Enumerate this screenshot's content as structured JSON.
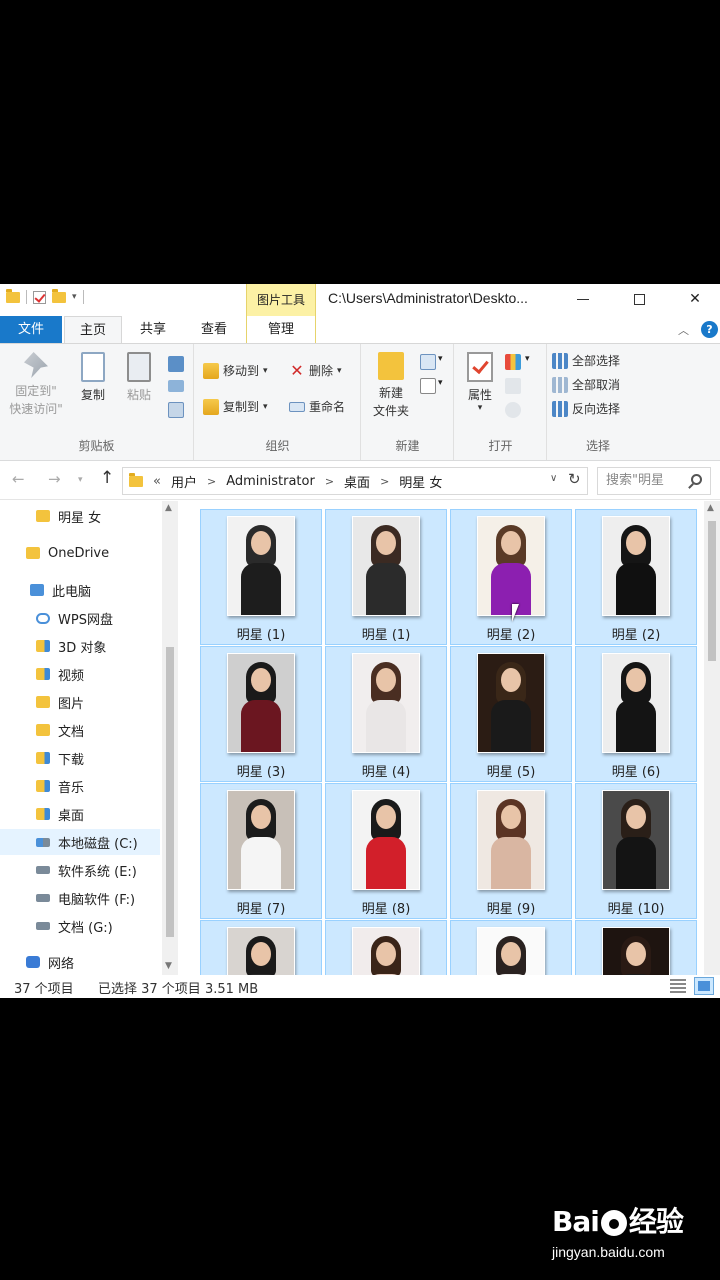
{
  "titlebar": {
    "context_tab_group": "图片工具",
    "path": "C:\\Users\\Administrator\\Deskto...",
    "minimize": "—",
    "maximize": "□",
    "close": "✕"
  },
  "tabs": {
    "file": "文件",
    "home": "主页",
    "share": "共享",
    "view": "查看",
    "manage": "管理"
  },
  "ribbon": {
    "clipboard": {
      "label": "剪贴板",
      "pin": "固定到\"快速访问\"",
      "pin_line1": "固定到\"",
      "pin_line2": "快速访问\"",
      "copy": "复制",
      "paste": "粘贴"
    },
    "organize": {
      "label": "组织",
      "move_to": "移动到",
      "copy_to": "复制到",
      "delete": "删除",
      "rename": "重命名"
    },
    "new": {
      "label": "新建",
      "new_folder_line1": "新建",
      "new_folder_line2": "文件夹"
    },
    "open": {
      "label": "打开",
      "properties": "属性"
    },
    "select": {
      "label": "选择",
      "select_all": "全部选择",
      "select_none": "全部取消",
      "invert": "反向选择"
    }
  },
  "address": {
    "crumbs": [
      "用户",
      "Administrator",
      "桌面",
      "明星 女"
    ],
    "overflow": "«",
    "search_placeholder": "搜索\"明星"
  },
  "navpane": {
    "items": [
      {
        "label": "明星 女",
        "icon": "folder-icon"
      },
      {
        "label": "OneDrive",
        "icon": "folder-icon"
      },
      {
        "label": "此电脑",
        "icon": "pc-icon"
      },
      {
        "label": "WPS网盘",
        "icon": "cloud-icon"
      },
      {
        "label": "3D 对象",
        "icon": "3d-objects-icon"
      },
      {
        "label": "视频",
        "icon": "video-folder-icon"
      },
      {
        "label": "图片",
        "icon": "pictures-folder-icon"
      },
      {
        "label": "文档",
        "icon": "documents-folder-icon"
      },
      {
        "label": "下载",
        "icon": "downloads-folder-icon"
      },
      {
        "label": "音乐",
        "icon": "music-folder-icon"
      },
      {
        "label": "桌面",
        "icon": "desktop-folder-icon"
      },
      {
        "label": "本地磁盘 (C:)",
        "icon": "drive-c-icon"
      },
      {
        "label": "软件系统 (E:)",
        "icon": "drive-icon"
      },
      {
        "label": "电脑软件 (F:)",
        "icon": "drive-icon"
      },
      {
        "label": "文档 (G:)",
        "icon": "drive-icon"
      },
      {
        "label": "网络",
        "icon": "network-icon"
      }
    ]
  },
  "files": [
    {
      "name": "明星 (1)",
      "hair": "#2a2a2a",
      "body": "#1d1d1d",
      "bg": "#f2f2f2"
    },
    {
      "name": "明星 (1)",
      "hair": "#3b2a22",
      "body": "#2b2b2b",
      "bg": "#e8e8e8"
    },
    {
      "name": "明星 (2)",
      "hair": "#5a3a26",
      "body": "#8c1fb0",
      "bg": "#f5f0e8"
    },
    {
      "name": "明星 (2)",
      "hair": "#151515",
      "body": "#101010",
      "bg": "#eeeeee"
    },
    {
      "name": "明星 (3)",
      "hair": "#1a1a1a",
      "body": "#6b1620",
      "bg": "#cfcfcf"
    },
    {
      "name": "明星 (4)",
      "hair": "#4a2e22",
      "body": "#e9e6e6",
      "bg": "#f1eeee"
    },
    {
      "name": "明星 (5)",
      "hair": "#3a2718",
      "body": "#1a1a1a",
      "bg": "#2b1c14"
    },
    {
      "name": "明星 (6)",
      "hair": "#151515",
      "body": "#141414",
      "bg": "#ededed"
    },
    {
      "name": "明星 (7)",
      "hair": "#1c1c1c",
      "body": "#f5f5f5",
      "bg": "#c8c0b8"
    },
    {
      "name": "明星 (8)",
      "hair": "#1a1a1a",
      "body": "#d21f2a",
      "bg": "#f3f3f3"
    },
    {
      "name": "明星 (9)",
      "hair": "#5b3424",
      "body": "#d9b6a2",
      "bg": "#efe8e2"
    },
    {
      "name": "明星 (10)",
      "hair": "#2a1f18",
      "body": "#141414",
      "bg": "#4a4a4a"
    },
    {
      "name": "",
      "hair": "#1a1a1a",
      "body": "#2a2a2a",
      "bg": "#d8d4d0"
    },
    {
      "name": "",
      "hair": "#3a2418",
      "body": "#e8d0c6",
      "bg": "#f1ecec"
    },
    {
      "name": "",
      "hair": "#2a2220",
      "body": "#f0eeee",
      "bg": "#fafafa"
    },
    {
      "name": "",
      "hair": "#2a1a14",
      "body": "#1c1c1c",
      "bg": "#1e1410"
    }
  ],
  "status": {
    "count": "37 个项目",
    "selected": "已选择 37 个项目  3.51 MB"
  },
  "watermark": {
    "brand_left": "Bai",
    "brand_right": "经验",
    "url": "jingyan.baidu.com"
  }
}
